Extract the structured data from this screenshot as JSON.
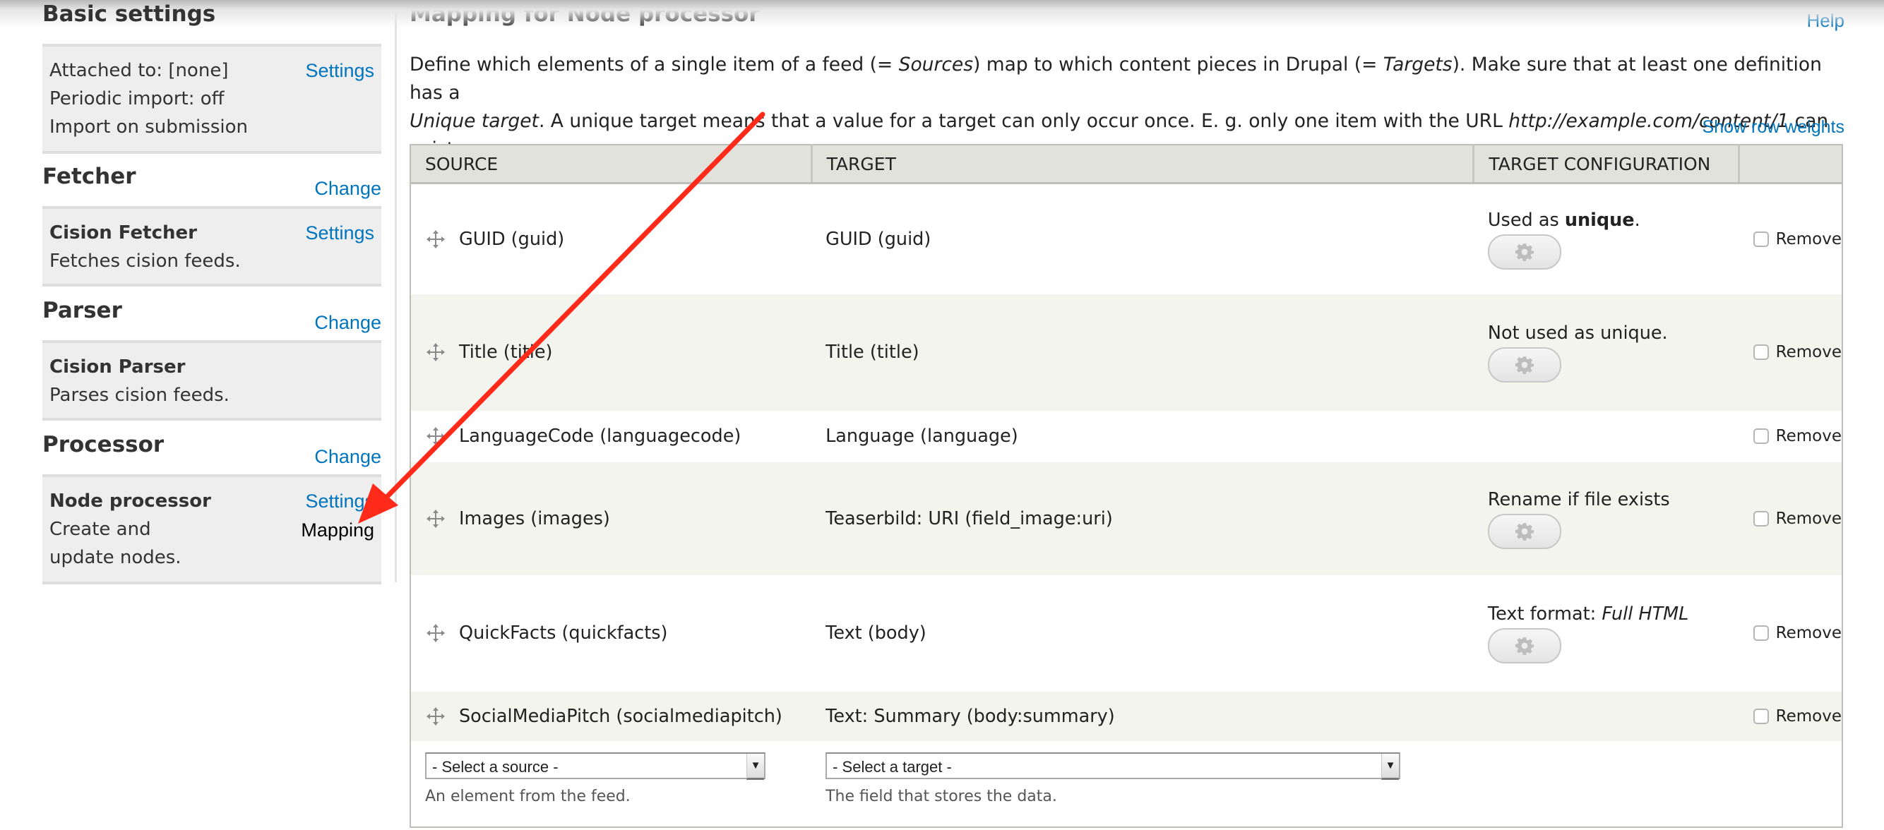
{
  "sidebar": {
    "basic": {
      "title": "Basic settings",
      "lines": [
        "Attached to: [none]",
        "Periodic import: off",
        "Import on submission"
      ],
      "settings_link": "Settings"
    },
    "fetcher": {
      "title": "Fetcher",
      "change_link": "Change",
      "plugin_name": "Cision Fetcher",
      "plugin_desc": "Fetches cision feeds.",
      "settings_link": "Settings"
    },
    "parser": {
      "title": "Parser",
      "change_link": "Change",
      "plugin_name": "Cision Parser",
      "plugin_desc": "Parses cision feeds."
    },
    "processor": {
      "title": "Processor",
      "change_link": "Change",
      "plugin_name": "Node processor",
      "plugin_desc": "Create and update nodes.",
      "settings_link": "Settings",
      "mapping_label": "Mapping"
    }
  },
  "main": {
    "title": "Mapping for Node processor",
    "help_link": "Help",
    "description": {
      "p1": "Define which elements of a single item of a feed (= ",
      "sources_em": "Sources",
      "p2": ") map to which content pieces in Drupal (= ",
      "targets_em": "Targets",
      "p3": "). Make sure that at least one definition has a ",
      "unique_em": "Unique target",
      "p4": ". A unique target means that a value for a target can only occur once. E. g. only one item with the URL ",
      "url_em": "http://example.com/content/1",
      "p5": " can exist."
    },
    "show_row_weights": "Show row weights",
    "table": {
      "headers": [
        "SOURCE",
        "TARGET",
        "TARGET CONFIGURATION",
        ""
      ],
      "rows": [
        {
          "source": "GUID (guid)",
          "target": "GUID (guid)",
          "config_prefix": "Used as ",
          "config_strong": "unique",
          "config_suffix": ".",
          "config_em": "",
          "has_gear": true,
          "remove_label": "Remove"
        },
        {
          "source": "Title (title)",
          "target": "Title (title)",
          "config_prefix": "Not used as unique.",
          "config_strong": "",
          "config_suffix": "",
          "config_em": "",
          "has_gear": true,
          "remove_label": "Remove"
        },
        {
          "source": "LanguageCode (languagecode)",
          "target": "Language (language)",
          "config_prefix": "",
          "config_strong": "",
          "config_suffix": "",
          "config_em": "",
          "has_gear": false,
          "remove_label": "Remove"
        },
        {
          "source": "Images (images)",
          "target": "Teaserbild: URI (field_image:uri)",
          "config_prefix": "Rename if file exists",
          "config_strong": "",
          "config_suffix": "",
          "config_em": "",
          "has_gear": true,
          "remove_label": "Remove"
        },
        {
          "source": "QuickFacts (quickfacts)",
          "target": "Text (body)",
          "config_prefix": "Text format: ",
          "config_strong": "",
          "config_suffix": "",
          "config_em": "Full HTML",
          "has_gear": true,
          "remove_label": "Remove"
        },
        {
          "source": "SocialMediaPitch (socialmediapitch)",
          "target": "Text: Summary (body:summary)",
          "config_prefix": "",
          "config_strong": "",
          "config_suffix": "",
          "config_em": "",
          "has_gear": false,
          "remove_label": "Remove"
        }
      ],
      "new_row": {
        "source_select": "- Select a source -",
        "source_desc": "An element from the feed.",
        "target_select": "- Select a target -",
        "target_desc": "The field that stores the data."
      }
    }
  },
  "annotation": {
    "type": "red-arrow",
    "color": "#ff2a1a",
    "points_to": "Mapping"
  },
  "colors": {
    "link": "#0074bd",
    "header_bg": "#e1e2dc",
    "row_alt_bg": "#f3f4ee",
    "sidebar_box_bg": "#eeeeee"
  }
}
